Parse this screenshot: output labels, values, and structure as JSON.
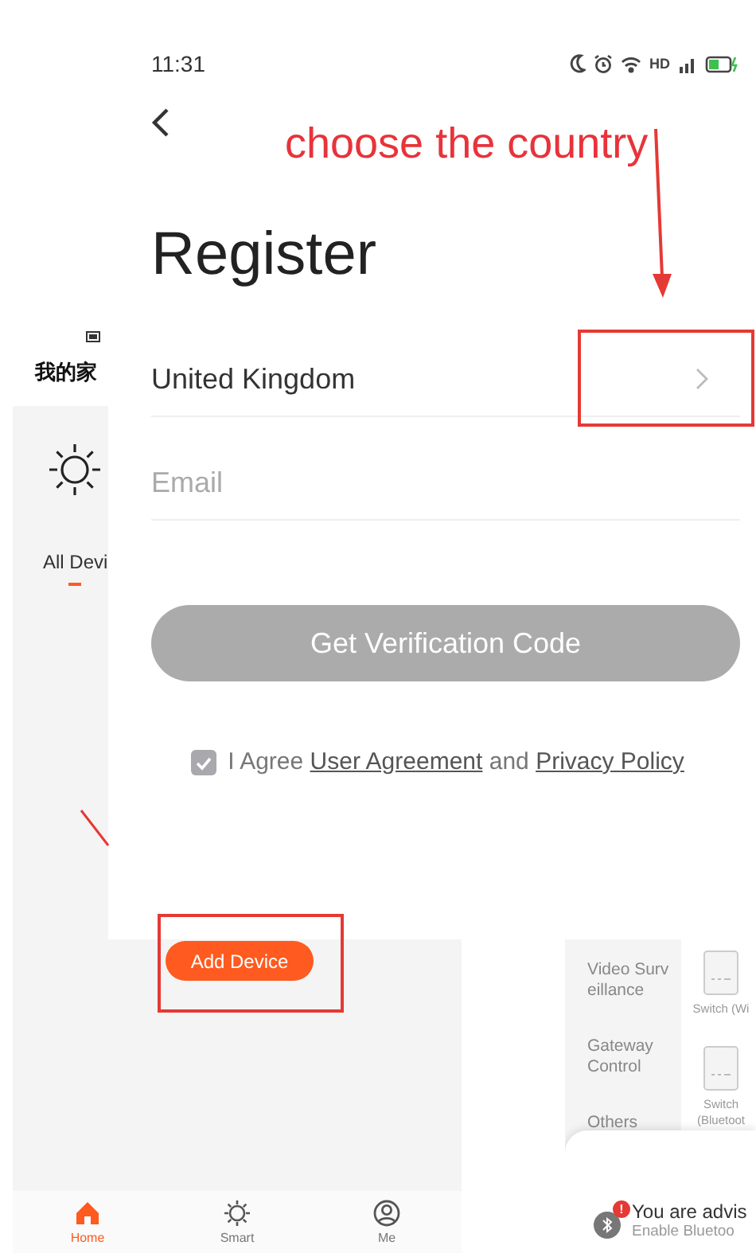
{
  "register_screen": {
    "status_bar": {
      "time": "11:31",
      "network": "HD"
    },
    "title": "Register",
    "country_field": {
      "value": "United Kingdom"
    },
    "email_field": {
      "placeholder": "Email"
    },
    "verification_button": {
      "label": "Get Verification Code",
      "disabled": true
    },
    "agreement": {
      "checked": true,
      "parts": [
        {
          "kind": "text",
          "text": "I Agree"
        },
        {
          "kind": "link",
          "text": "User Agreement"
        },
        {
          "kind": "text",
          "text": "and"
        },
        {
          "kind": "link",
          "text": "Privacy Policy"
        }
      ]
    }
  },
  "home_screen": {
    "header": {
      "title": "我的家"
    },
    "device_tab": {
      "label": "All Devi",
      "selected": true
    },
    "add_device_button": {
      "label": "Add Device"
    },
    "bottom_nav": [
      {
        "label": "Home",
        "selected": true
      },
      {
        "label": "Smart",
        "selected": false
      },
      {
        "label": "Me",
        "selected": false
      }
    ]
  },
  "add_device_screen": {
    "categories": [
      {
        "label": "Video Surv eillance"
      },
      {
        "label": "Gateway Control"
      },
      {
        "label": "Others"
      }
    ],
    "devices": [
      {
        "label": "Switch (Wi"
      },
      {
        "label": "Switch (Bluetoot"
      }
    ],
    "notice": {
      "badge": "!",
      "title": "You are advis",
      "subtitle": "Enable Bluetoo"
    }
  },
  "annotation": {
    "text": "choose the country"
  }
}
